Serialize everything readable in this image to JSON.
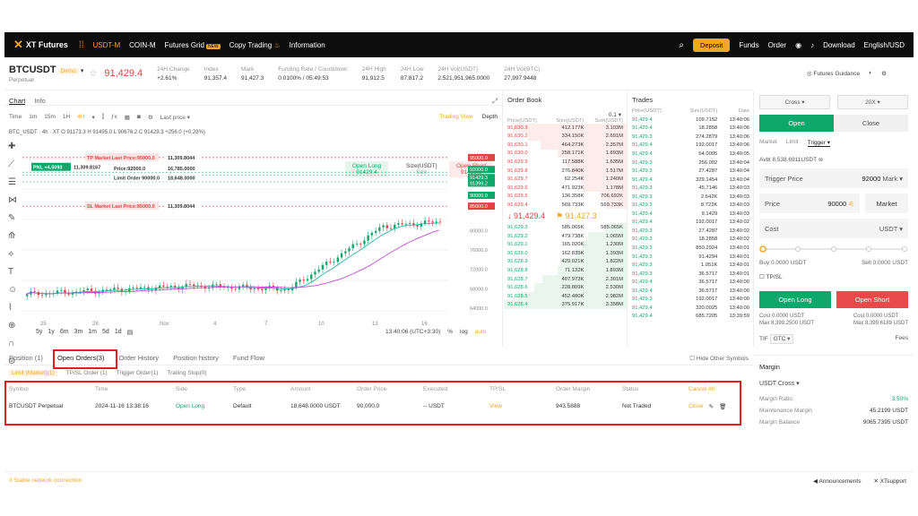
{
  "header": {
    "logo": "XT Futures",
    "nav": [
      "USDT-M",
      "COIN-M",
      "Futures Grid",
      "Copy Trading",
      "Information"
    ],
    "new_badge": "NEW",
    "deposit": "Deposit",
    "right": [
      "Funds",
      "Order",
      "Download",
      "English/USD"
    ]
  },
  "ticker": {
    "symbol": "BTCUSDT",
    "type": "Perpetual",
    "demo": "Demo",
    "last": "91,429.4",
    "stats": [
      {
        "label": "24H Change",
        "value": "+2.61%"
      },
      {
        "label": "Index",
        "value": "91,357.4"
      },
      {
        "label": "Mark",
        "value": "91,427.3"
      },
      {
        "label": "Funding Rate / Countdown",
        "value": "0.0100% / 05:49:53"
      },
      {
        "label": "24H High",
        "value": "91,912.5"
      },
      {
        "label": "24H Low",
        "value": "87,817.2"
      },
      {
        "label": "24H Vol(USDT)",
        "value": "2,521,951,965.0000"
      },
      {
        "label": "24H Vol(BTC)",
        "value": "27,997.9448"
      }
    ],
    "guidance": "Futures Guidance"
  },
  "chart": {
    "tabs": [
      "Chart",
      "Info"
    ],
    "intervals": [
      "Time",
      "1m",
      "15m",
      "1H",
      "4H"
    ],
    "last_price_label": "Last price",
    "views": [
      "Trading View",
      "Depth"
    ],
    "ohlc": "BTC_USDT · 4h · XT  O 91173.3  H 91495.0  L 90676.2  C 91429.3  +256.0 (+0.28%)",
    "open_long": {
      "title": "Open Long",
      "value": "91429.4"
    },
    "size": {
      "title": "Size(USDT)",
      "value": "Size"
    },
    "open_short": {
      "title": "Open Short",
      "value": "91429.3"
    },
    "tp_label": "TP Market Last Price:95000.0",
    "tp_size": "11,309.8044",
    "pnl_label": "PNL +4.5093",
    "pnl_size": "11,309.8167",
    "price_label": "Price:92000.0",
    "price_size": "16,785.0000",
    "limit_label": "Limit Order 90000.0",
    "limit_size": "18,648.0000",
    "sl_label": "SL Market Last Price:85000.0",
    "sl_size": "11,309.8044",
    "yaxis": [
      "95000.0",
      "92000.0",
      "91429.3",
      "91399.2",
      "90000.0",
      "85000.0",
      "80000.0",
      "76000.0",
      "72000.0",
      "68000.0",
      "64000.0"
    ],
    "xaxis": [
      "25",
      "28",
      "Nov",
      "4",
      "7",
      "10",
      "13",
      "16"
    ],
    "ranges": [
      "5y",
      "1y",
      "6m",
      "3m",
      "1m",
      "5d",
      "1d"
    ],
    "clock": "13:40:06 (UTC+3:30)",
    "scale": [
      "%",
      "log",
      "auto"
    ]
  },
  "orderbook": {
    "title": "Order Book",
    "agg": "0.1",
    "head": [
      "Price(USDT)",
      "Size(USDT)",
      "Sum(USDT)"
    ],
    "asks": [
      [
        "91,630.3",
        "412.177K",
        "3.103M"
      ],
      [
        "91,630.2",
        "334.150K",
        "2.691M"
      ],
      [
        "91,630.1",
        "464.273K",
        "2.357M"
      ],
      [
        "91,630.0",
        "258.171K",
        "1.893M"
      ],
      [
        "91,629.9",
        "117.588K",
        "1.635M"
      ],
      [
        "91,629.8",
        "276.840K",
        "1.517M"
      ],
      [
        "91,629.7",
        "62.254K",
        "1.240M"
      ],
      [
        "91,629.6",
        "471.923K",
        "1.178M"
      ],
      [
        "91,629.5",
        "136.358K",
        "706.692K"
      ],
      [
        "91,629.4",
        "569.733K",
        "569.733K"
      ]
    ],
    "mid_last": "91,429.4",
    "mid_mark": "91,427.3",
    "bids": [
      [
        "91,629.3",
        "585.065K",
        "585.065K"
      ],
      [
        "91,629.2",
        "479.738K",
        "1.065M"
      ],
      [
        "91,629.1",
        "165.020K",
        "1.230M"
      ],
      [
        "91,629.0",
        "162.835K",
        "1.393M"
      ],
      [
        "91,628.9",
        "429.021K",
        "1.822M"
      ],
      [
        "91,628.8",
        "71.132K",
        "1.893M"
      ],
      [
        "91,628.7",
        "407.973K",
        "2.301M"
      ],
      [
        "91,628.6",
        "228.809K",
        "2.530M"
      ],
      [
        "91,628.5",
        "452.480K",
        "2.982M"
      ],
      [
        "91,628.4",
        "375.917K",
        "3.358M"
      ]
    ]
  },
  "trades": {
    "title": "Trades",
    "head": [
      "Price(USDT)",
      "Size(USDT)",
      "Date"
    ],
    "rows": [
      [
        "91,429.4",
        "109.7152",
        "13:40:06"
      ],
      [
        "91,429.4",
        "18.2858",
        "13:40:06"
      ],
      [
        "91,429.3",
        "274.2879",
        "13:40:06"
      ],
      [
        "91,429.4",
        "192.0017",
        "13:40:06"
      ],
      [
        "91,429.4",
        "64.0005",
        "13:40:05"
      ],
      [
        "91,429.3",
        "256.002",
        "13:40:04"
      ],
      [
        "91,429.3",
        "27.4287",
        "13:40:04"
      ],
      [
        "91,429.4",
        "329.1454",
        "13:40:04"
      ],
      [
        "91,429.3",
        "45.7146",
        "13:40:03"
      ],
      [
        "91,429.3",
        "2.642K",
        "13:40:03"
      ],
      [
        "91,429.3",
        "8.722K",
        "13:40:03"
      ],
      [
        "91,429.4",
        "9.1429",
        "13:40:03"
      ],
      [
        "91,429.4",
        "192.0017",
        "13:40:02"
      ],
      [
        "91,429.3",
        "27.4287",
        "13:40:02"
      ],
      [
        "91,429.3",
        "18.2858",
        "13:40:02"
      ],
      [
        "91,429.3",
        "850.2924",
        "13:40:01"
      ],
      [
        "91,429.3",
        "91.4294",
        "13:40:01"
      ],
      [
        "91,429.3",
        "1.051K",
        "13:40:01"
      ],
      [
        "91,429.3",
        "36.5717",
        "13:40:01"
      ],
      [
        "91,429.4",
        "36.5717",
        "13:40:00"
      ],
      [
        "91,429.4",
        "36.5717",
        "13:40:00"
      ],
      [
        "91,429.3",
        "192.0017",
        "13:40:00"
      ],
      [
        "91,429.4",
        "320.0025",
        "13:40:00"
      ],
      [
        "91,429.4",
        "685.7205",
        "13:39:59"
      ]
    ]
  },
  "trade_panel": {
    "margin_mode": "Cross",
    "leverage": "20X",
    "open": "Open",
    "close": "Close",
    "types": [
      "Market",
      "Limit",
      "Trigger"
    ],
    "avbl_label": "Avbl",
    "avbl": "8,538.6911USDT",
    "trigger_price_label": "Trigger Price",
    "trigger_price": "92000",
    "trigger_type": "Mark",
    "price_label": "Price",
    "price": "90000",
    "price_market": "Market",
    "cost_label": "Cost",
    "cost_unit": "USDT",
    "buy": "Buy 0.0000 USDT",
    "sell": "Sell 0.0000 USDT",
    "tpsl": "TP/SL",
    "open_long": "Open Long",
    "open_short": "Open Short",
    "cost_long": "Cost 0.0000 USDT",
    "cost_short": "Cost 0.0000 USDT",
    "max_long": "Max 8,399.2500 USDT",
    "max_short": "Max 8,399.6189 USDT",
    "tif": "TIF",
    "gtc": "GTC",
    "fees": "Fees",
    "margin_title": "Margin",
    "margin_mode2": "USDT Cross",
    "margin_ratio_label": "Margin Ratio",
    "margin_ratio": "3.50%",
    "maint_label": "Maintenance Margin",
    "maint": "45.2199 USDT",
    "balance_label": "Margin Balance",
    "balance": "9065.7395 USDT"
  },
  "orders": {
    "tabs": [
      "Position (1)",
      "Open Orders(3)",
      "Order History",
      "Position history",
      "Fund Flow"
    ],
    "hide_other": "Hide Other Symbols",
    "subtabs": [
      "Limit (Market)(1)",
      "TP/SL Order (1)",
      "Trigger Order(1)",
      "Trailing Stop(0)"
    ],
    "columns": [
      "Symbol",
      "Time",
      "Side",
      "Type",
      "Amount",
      "Order Price",
      "Executed",
      "TP/SL",
      "Order Margin",
      "Status",
      "Cancel All"
    ],
    "row": [
      "BTCUSDT Perpetual",
      "2024-11-16 13:38:16",
      "Open Long",
      "Default",
      "18,648.0000 USDT",
      "90,000.0",
      "-- USDT",
      "View",
      "943.5888",
      "Not Traded",
      "Close"
    ]
  },
  "status": {
    "network": "Stable network connection",
    "announcements": "Announcements",
    "support": "XTsupport"
  }
}
